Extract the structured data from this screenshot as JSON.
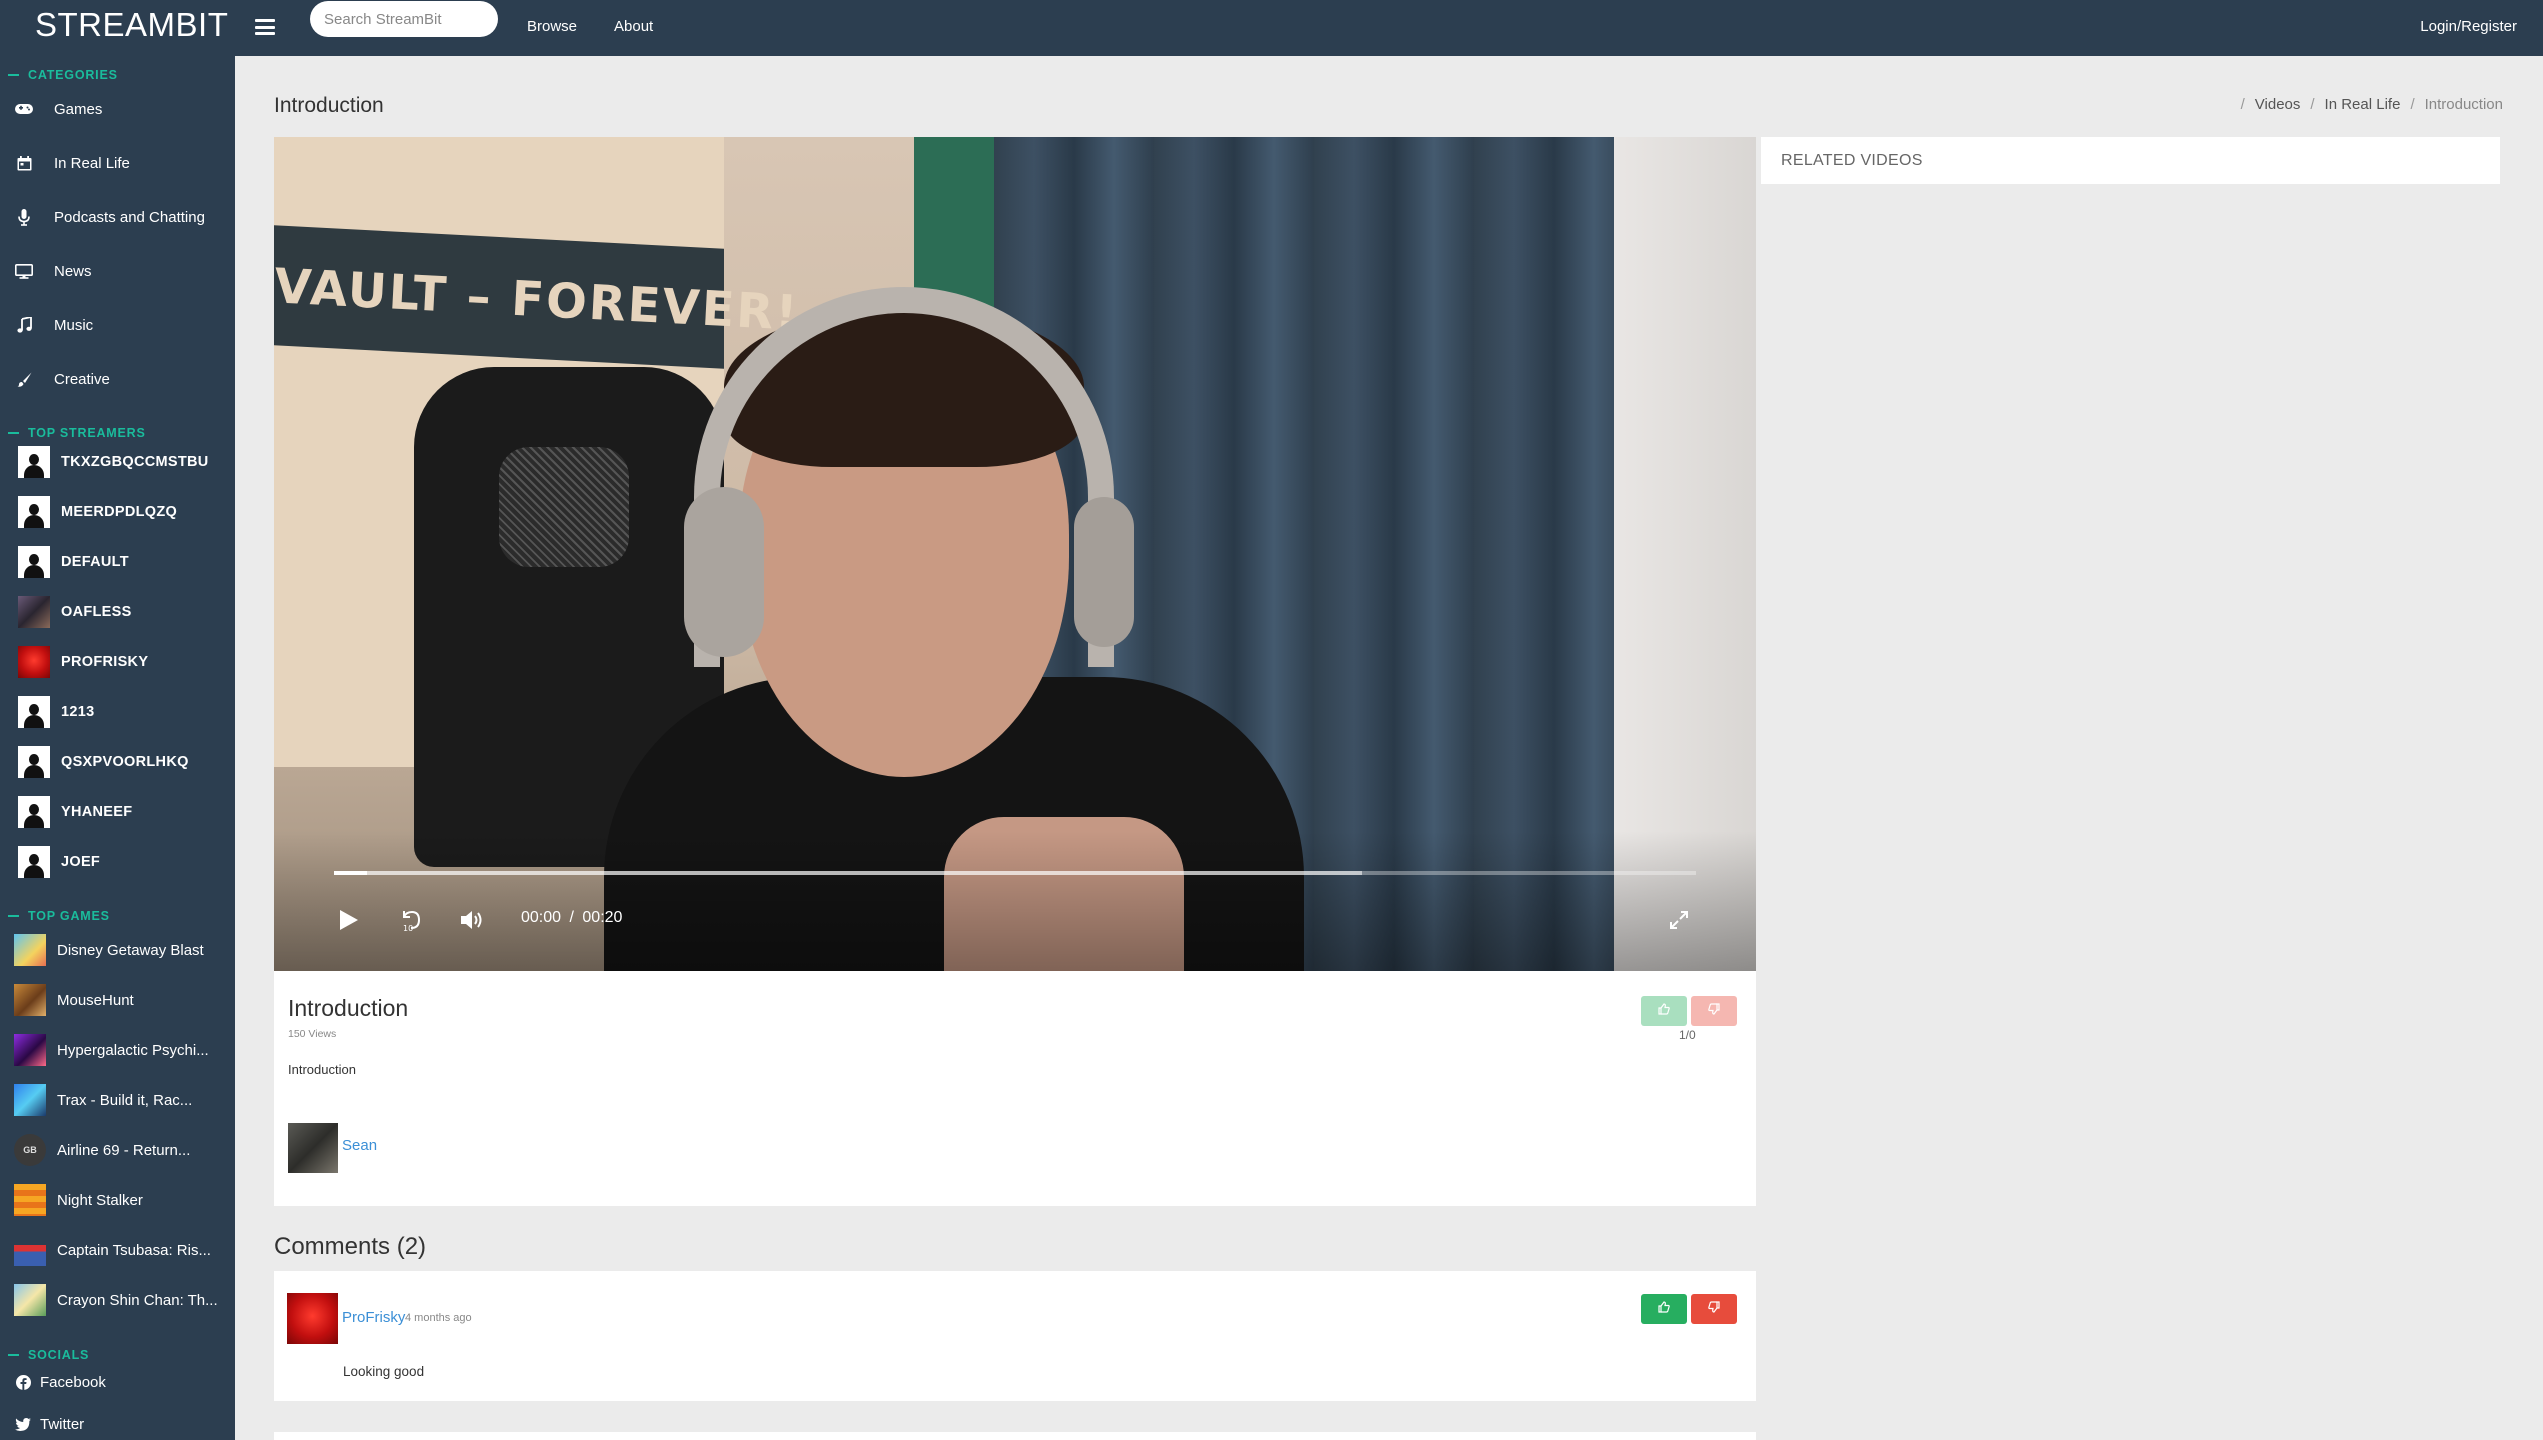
{
  "app": {
    "logo": "STREAMBIT"
  },
  "header": {
    "search_placeholder": "Search StreamBit",
    "nav": [
      "Browse",
      "About"
    ],
    "login": "Login/Register"
  },
  "sidebar": {
    "categories_title": "CATEGORIES",
    "categories": [
      {
        "label": "Games",
        "icon": "gamepad-icon"
      },
      {
        "label": "In Real Life",
        "icon": "calendar-icon"
      },
      {
        "label": "Podcasts and Chatting",
        "icon": "microphone-icon"
      },
      {
        "label": "News",
        "icon": "monitor-icon"
      },
      {
        "label": "Music",
        "icon": "music-icon"
      },
      {
        "label": "Creative",
        "icon": "brush-icon"
      }
    ],
    "streamers_title": "TOP STREAMERS",
    "streamers": [
      "TKXZGBQCCMSTBU",
      "MEERDPDLQZQ",
      "DEFAULT",
      "OAFLESS",
      "PROFRISKY",
      "1213",
      "QSXPVOORLHKQ",
      "YHANEEF",
      "JOEF"
    ],
    "games_title": "TOP GAMES",
    "games": [
      "Disney Getaway Blast",
      "MouseHunt",
      "Hypergalactic Psychi...",
      "Trax - Build it, Rac...",
      "Airline 69 - Return...",
      "Night Stalker",
      "Captain Tsubasa: Ris...",
      "Crayon Shin Chan: Th..."
    ],
    "socials_title": "SOCIALS",
    "socials": [
      {
        "label": "Facebook",
        "icon": "facebook-icon"
      },
      {
        "label": "Twitter",
        "icon": "twitter-icon"
      }
    ]
  },
  "page": {
    "title": "Introduction",
    "breadcrumb": [
      "Videos",
      "In Real Life",
      "Introduction"
    ]
  },
  "player": {
    "poster_text": "VAULT – FOREVER!",
    "current_time": "00:00",
    "separator": "/",
    "duration": "00:20",
    "played_fraction": 0.024,
    "buffered_fraction": 0.755
  },
  "video_info": {
    "title": "Introduction",
    "views": "150 Views",
    "description": "Introduction",
    "author": "Sean",
    "vote_ratio": "1/0"
  },
  "related": {
    "title": "RELATED VIDEOS"
  },
  "comments": {
    "heading": "Comments (2)",
    "items": [
      {
        "user": "ProFrisky",
        "time": "4 months ago",
        "text": "Looking good"
      }
    ]
  },
  "colors": {
    "topbar": "#2c3e50",
    "accent": "#1abc9c",
    "link": "#3b8fd6",
    "like": "#27ae60",
    "dislike": "#e74c3c"
  }
}
